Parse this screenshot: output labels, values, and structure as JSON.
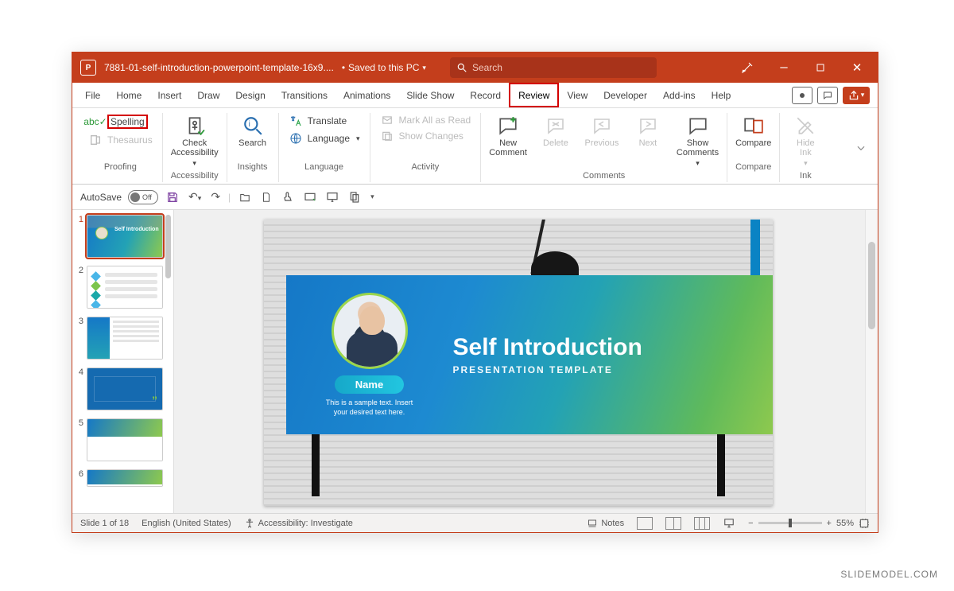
{
  "titlebar": {
    "doc_name": "7881-01-self-introduction-powerpoint-template-16x9....",
    "save_state": "Saved to this PC",
    "search_placeholder": "Search"
  },
  "tabs": {
    "file": "File",
    "home": "Home",
    "insert": "Insert",
    "draw": "Draw",
    "design": "Design",
    "transitions": "Transitions",
    "animations": "Animations",
    "slideshow": "Slide Show",
    "record": "Record",
    "review": "Review",
    "view": "View",
    "developer": "Developer",
    "addins": "Add-ins",
    "help": "Help"
  },
  "ribbon": {
    "spelling": "Spelling",
    "thesaurus": "Thesaurus",
    "check_accessibility": "Check\nAccessibility",
    "search": "Search",
    "translate": "Translate",
    "language": "Language",
    "mark_read": "Mark All as Read",
    "show_changes": "Show Changes",
    "new_comment": "New\nComment",
    "delete": "Delete",
    "previous": "Previous",
    "next": "Next",
    "show_comments": "Show\nComments",
    "compare": "Compare",
    "hide_ink": "Hide\nInk",
    "groups": {
      "proofing": "Proofing",
      "accessibility": "Accessibility",
      "insights": "Insights",
      "language": "Language",
      "activity": "Activity",
      "comments": "Comments",
      "compare": "Compare",
      "ink": "Ink"
    }
  },
  "qat": {
    "autosave": "AutoSave",
    "autosave_state": "Off"
  },
  "slide": {
    "title": "Self Introduction",
    "subtitle": "PRESENTATION TEMPLATE",
    "name": "Name",
    "sample_l1": "This is a sample text. Insert",
    "sample_l2": "your desired text here."
  },
  "thumbs": {
    "n1": "1",
    "n2": "2",
    "n3": "3",
    "n4": "4",
    "n5": "5",
    "n6": "6"
  },
  "status": {
    "slide": "Slide 1 of 18",
    "lang": "English (United States)",
    "accessibility": "Accessibility: Investigate",
    "notes": "Notes",
    "zoom": "55%"
  },
  "watermark": "SLIDEMODEL.COM"
}
